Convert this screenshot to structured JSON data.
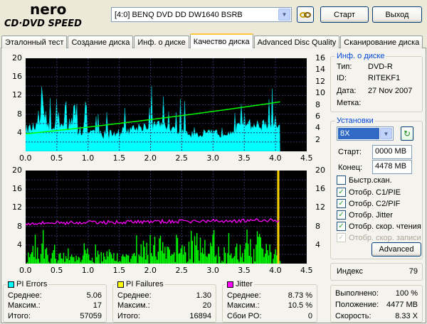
{
  "app": {
    "logo_top": "nero",
    "logo_bottom": "CD·DVD SPEED",
    "drive": "[4:0]  BENQ DVD DD DW1640 BSRB",
    "start_label": "Старт",
    "exit_label": "Выход"
  },
  "tabs": [
    {
      "label": "Эталонный тест"
    },
    {
      "label": "Создание диска"
    },
    {
      "label": "Инф. о диске"
    },
    {
      "label": "Качество диска"
    },
    {
      "label": "Advanced Disc Quality"
    },
    {
      "label": "Сканирование диска"
    }
  ],
  "disc_info": {
    "title": "Инф. о диске",
    "type_label": "Тип:",
    "type_value": "DVD-R",
    "id_label": "ID:",
    "id_value": "RITEKF1",
    "date_label": "Дата:",
    "date_value": "27 Nov 2007",
    "label_label": "Метка:",
    "label_value": ""
  },
  "settings": {
    "title": "Установки",
    "speed": "8X",
    "start_label": "Старт:",
    "start_value": "0000 MB",
    "end_label": "Конец:",
    "end_value": "4478 MB",
    "checks": [
      {
        "label": "Быстр.скан.",
        "checked": false,
        "disabled": false
      },
      {
        "label": "Отобр. C1/PIE",
        "checked": true,
        "disabled": false
      },
      {
        "label": "Отобр. C2/PIF",
        "checked": true,
        "disabled": false
      },
      {
        "label": "Отобр. Jitter",
        "checked": true,
        "disabled": false
      },
      {
        "label": "Отобр. скор. чтения",
        "checked": true,
        "disabled": false
      },
      {
        "label": "Отобр. скор. записи",
        "checked": true,
        "disabled": true
      }
    ],
    "advanced_label": "Advanced"
  },
  "index": {
    "label": "Индекс",
    "value": "79"
  },
  "progress": {
    "done_label": "Выполнено:",
    "done_value": "100 %",
    "pos_label": "Положение:",
    "pos_value": "4477 MB",
    "speed_label": "Скорость:",
    "speed_value": "8.33 X"
  },
  "stats": {
    "pi_errors": {
      "title": "PI Errors",
      "color": "#00ffff",
      "avg_label": "Среднее:",
      "avg": "5.06",
      "max_label": "Максим.:",
      "max": "17",
      "total_label": "Итого:",
      "total": "57059"
    },
    "pi_failures": {
      "title": "PI Failures",
      "color": "#ffff00",
      "avg_label": "Среднее:",
      "avg": "1.30",
      "max_label": "Максим.:",
      "max": "20",
      "total_label": "Итого:",
      "total": "16894"
    },
    "jitter": {
      "title": "Jitter",
      "color": "#ff00ff",
      "avg_label": "Среднее:",
      "avg": "8.73 %",
      "max_label": "Максим.:",
      "max": "10.5 %",
      "po_label": "Сбои PO:",
      "po": "0"
    }
  },
  "chart_data": [
    {
      "type": "area",
      "series": [
        {
          "name": "PI Errors",
          "color": "#00ffff"
        },
        {
          "color": "#00ff00"
        }
      ],
      "x_ticks": [
        "0.0",
        "0.5",
        "1.0",
        "1.5",
        "2.0",
        "2.5",
        "3.0",
        "3.5",
        "4.0",
        "4.5"
      ],
      "y_ticks_left": [
        "20",
        "16",
        "12",
        "8",
        "4"
      ],
      "y_ticks_right": [
        "16",
        "14",
        "12",
        "10",
        "8",
        "6",
        "4",
        "2"
      ],
      "xlim": [
        0,
        4.5
      ],
      "ylim": [
        0,
        20
      ],
      "y2lim": [
        0,
        16
      ],
      "grid": true,
      "speed_start": 3.0,
      "speed_end": 8.5,
      "max_value": 17,
      "average_value": 5.06
    },
    {
      "type": "bar",
      "series": [
        {
          "name": "PI Failures",
          "color": "#00ff00"
        },
        {
          "name": "Jitter",
          "color": "#ff00ff"
        }
      ],
      "x_ticks": [
        "0.0",
        "0.5",
        "1.0",
        "1.5",
        "2.0",
        "2.5",
        "3.0",
        "3.5",
        "4.0",
        "4.5"
      ],
      "y_ticks_left": [
        "20",
        "16",
        "12",
        "8",
        "4"
      ],
      "y_ticks_right": [
        "20",
        "16",
        "12",
        "8",
        "4"
      ],
      "xlim": [
        0,
        4.5
      ],
      "ylim": [
        0,
        20
      ],
      "grid": true,
      "jitter_level": 8.7,
      "max_value": 20,
      "average_value": 1.3
    }
  ]
}
